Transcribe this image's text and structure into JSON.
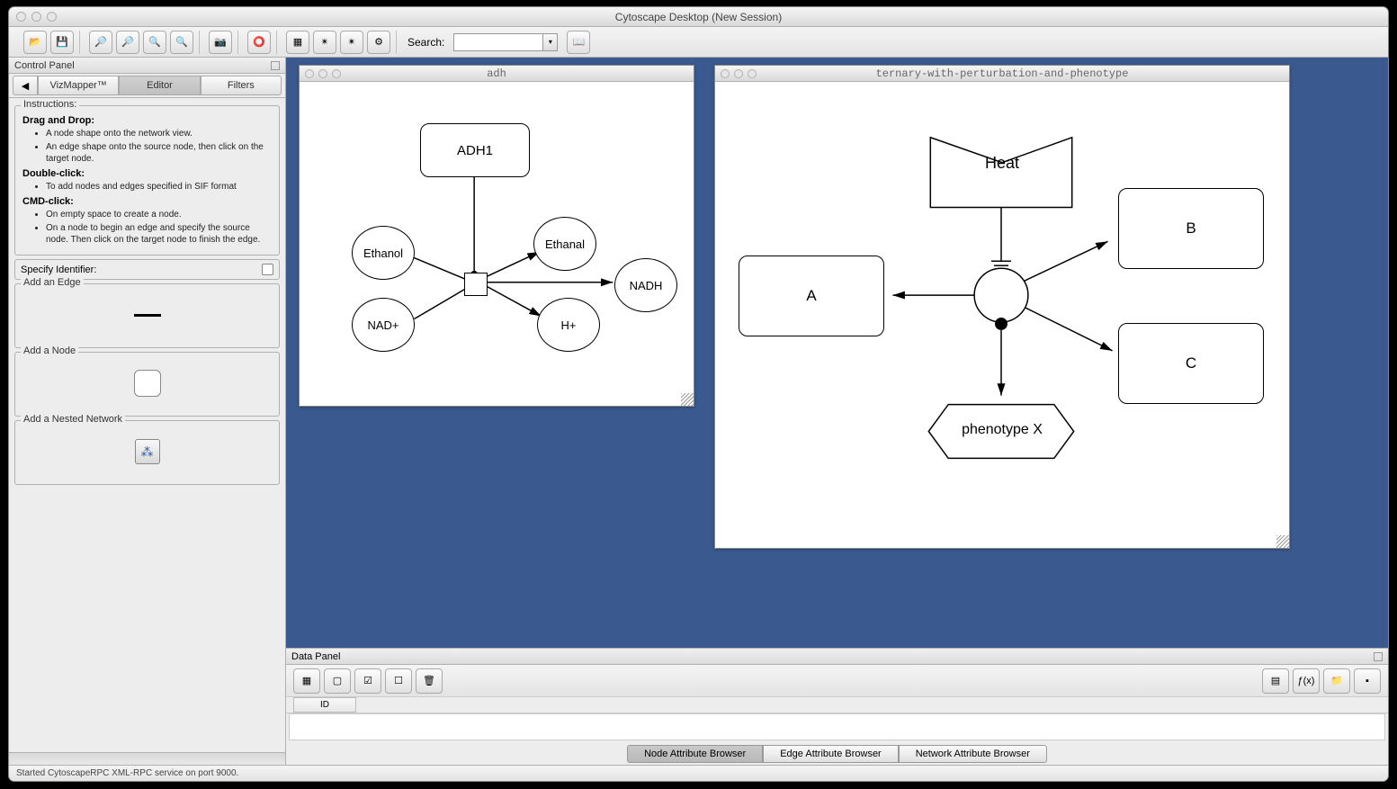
{
  "window": {
    "title": "Cytoscape Desktop (New Session)"
  },
  "toolbar": {
    "search_label": "Search:",
    "search_value": ""
  },
  "control_panel": {
    "title": "Control Panel",
    "tabs": {
      "vizmapper": "VizMapper™",
      "editor": "Editor",
      "filters": "Filters"
    },
    "instructions": {
      "title": "Instructions:",
      "drag_drop_h": "Drag and Drop:",
      "drag_drop_1": "A node shape onto the network view.",
      "drag_drop_2": "An edge shape onto the source node, then click on the target node.",
      "dbl_h": "Double-click:",
      "dbl_1": "To add nodes and edges specified in SIF format",
      "cmd_h": "CMD-click:",
      "cmd_1": "On empty space to create a node.",
      "cmd_2": "On a node to begin an edge and specify the source node. Then click on the target node to finish the edge."
    },
    "specify": "Specify Identifier:",
    "add_edge": "Add an Edge",
    "add_node": "Add a Node",
    "add_nested": "Add a Nested Network"
  },
  "networks": {
    "adh": {
      "title": "adh",
      "nodes": {
        "adh1": "ADH1",
        "ethanol": "Ethanol",
        "nad": "NAD+",
        "ethanal": "Ethanal",
        "h": "H+",
        "nadh": "NADH"
      }
    },
    "ternary": {
      "title": "ternary-with-perturbation-and-phenotype",
      "nodes": {
        "heat": "Heat",
        "a": "A",
        "b": "B",
        "c": "C",
        "phenotype": "phenotype X"
      }
    }
  },
  "data_panel": {
    "title": "Data Panel",
    "col_id": "ID",
    "tabs": {
      "node": "Node Attribute Browser",
      "edge": "Edge Attribute Browser",
      "network": "Network Attribute Browser"
    }
  },
  "status": "Started CytoscapeRPC XML-RPC service on port 9000."
}
